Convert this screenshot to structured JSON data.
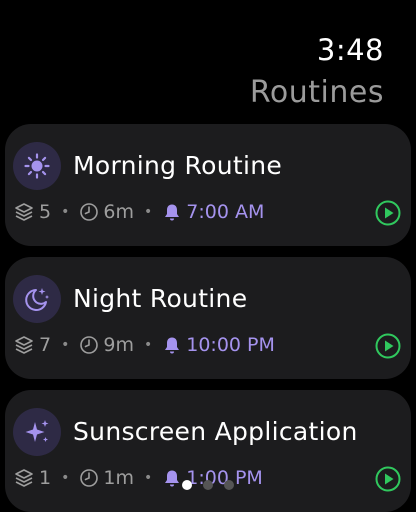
{
  "status": {
    "time": "3:48"
  },
  "header": {
    "title": "Routines"
  },
  "routines": [
    {
      "title": "Morning Routine",
      "icon": "sun-icon",
      "steps": "5",
      "duration": "6m",
      "alarm": "7:00 AM"
    },
    {
      "title": "Night Routine",
      "icon": "moon-stars-icon",
      "steps": "7",
      "duration": "9m",
      "alarm": "10:00 PM"
    },
    {
      "title": "Sunscreen Application",
      "icon": "sparkles-icon",
      "steps": "1",
      "duration": "1m",
      "alarm": "1:00 PM"
    }
  ],
  "pager": {
    "count": 3,
    "active_index": 0
  },
  "colors": {
    "accent_purple": "#a593ee",
    "play_green": "#30c85e",
    "card_bg": "#1c1c1e",
    "icon_bg": "#2e2a45",
    "title_gray": "#9b9b9b"
  }
}
